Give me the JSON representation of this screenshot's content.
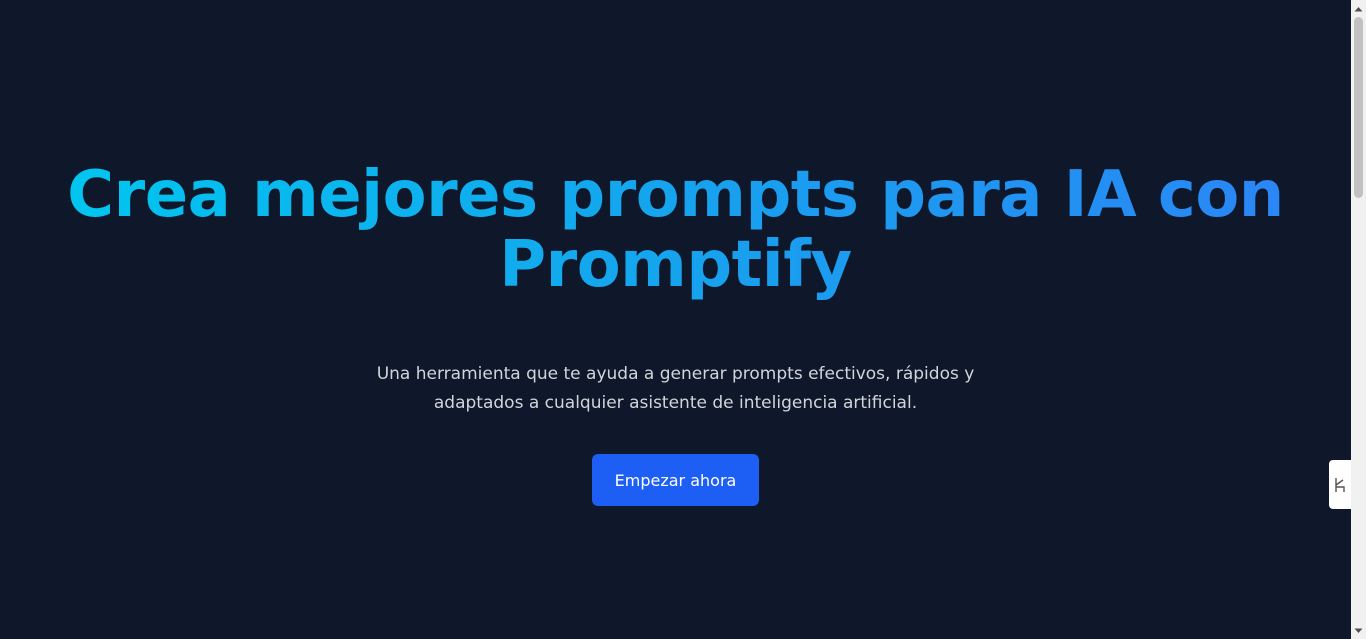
{
  "hero": {
    "title": "Crea mejores prompts para IA con Promptify",
    "subtitle": "Una herramienta que te ayuda a generar prompts efectivos, rápidos y adaptados a cualquier asistente de inteligencia artificial.",
    "cta_label": "Empezar ahora"
  },
  "side_widget": {
    "icon": "extension-handle-icon"
  },
  "colors": {
    "background": "#0f172a",
    "title_gradient_start": "#00c6ef",
    "title_gradient_end": "#2b86f5",
    "subtitle": "#d1d5db",
    "button": "#1d5ef5",
    "button_text": "#ffffff"
  }
}
